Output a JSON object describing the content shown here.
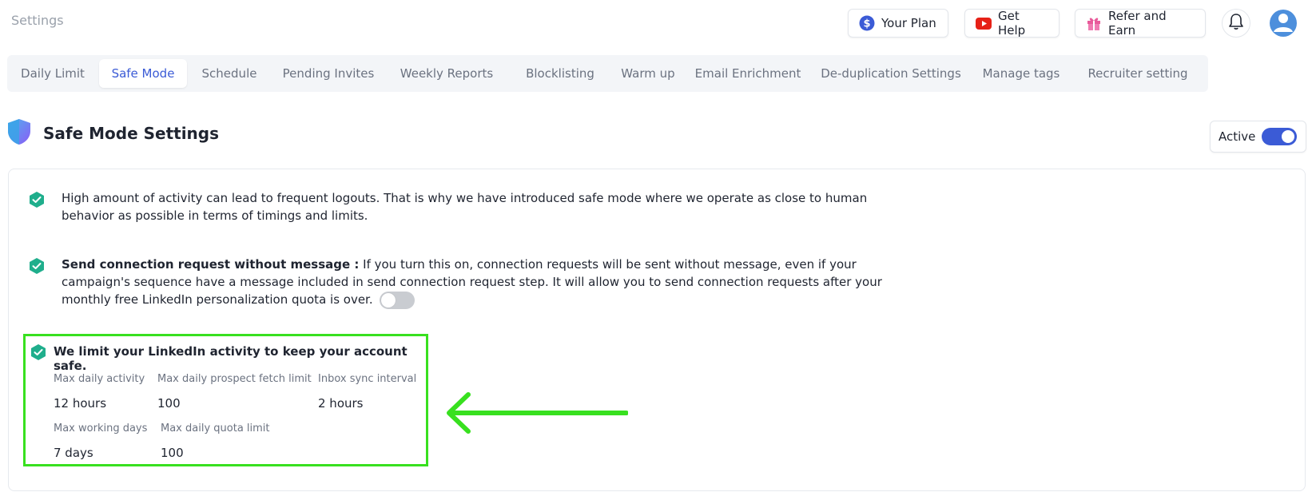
{
  "header": {
    "title": "Settings",
    "actions": {
      "plan_label": "Your Plan",
      "help_label": "Get Help",
      "refer_label": "Refer and Earn"
    },
    "icons": [
      "dollar-icon",
      "youtube-icon",
      "gift-icon",
      "bell-icon",
      "user-avatar-icon"
    ]
  },
  "tabs": [
    {
      "label": "Daily Limit"
    },
    {
      "label": "Safe Mode",
      "active": true
    },
    {
      "label": "Schedule"
    },
    {
      "label": "Pending Invites"
    },
    {
      "label": "Weekly Reports"
    },
    {
      "label": "Blocklisting"
    },
    {
      "label": "Warm up"
    },
    {
      "label": "Email Enrichment"
    },
    {
      "label": "De-duplication Settings"
    },
    {
      "label": "Manage tags"
    },
    {
      "label": "Recruiter setting"
    }
  ],
  "section": {
    "title": "Safe Mode Settings",
    "status_label": "Active",
    "status_on": true
  },
  "info": {
    "intro": "High amount of activity can lead to frequent logouts. That is why we have introduced safe mode where we operate as close to human behavior as possible in terms of timings and limits.",
    "connection_title": "Send connection request without message :",
    "connection_text": " If you turn this on, connection requests will be sent without message, even if your campaign's sequence have a message included in send connection request step. It will allow you to send connection requests after your monthly free LinkedIn personalization quota is over.",
    "connection_toggle_on": false
  },
  "limits": {
    "title": "We limit your LinkedIn activity to keep your account safe.",
    "stats": [
      {
        "label": "Max daily activity",
        "value": "12 hours"
      },
      {
        "label": "Max daily prospect fetch limit",
        "value": "100"
      },
      {
        "label": "Inbox sync interval",
        "value": "2 hours"
      },
      {
        "label": "Max working days",
        "value": "7 days"
      },
      {
        "label": "Max daily quota limit",
        "value": "100"
      }
    ]
  },
  "colors": {
    "accent": "#3b5bd6",
    "check": "#1fae8c",
    "highlight": "#38e01f"
  }
}
